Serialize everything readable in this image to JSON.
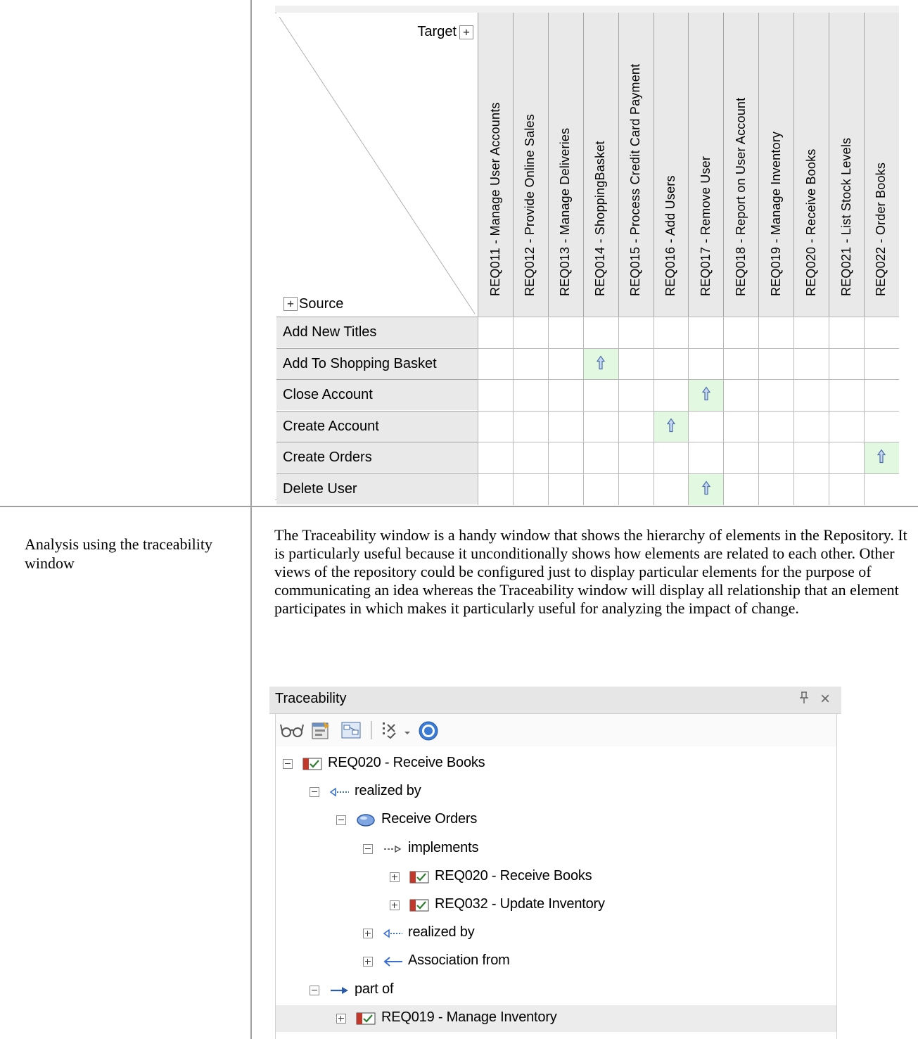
{
  "matrix": {
    "corner_target": "Target",
    "corner_source": "Source",
    "plus_symbol": "+",
    "columns": [
      "REQ011 - Manage User Accounts",
      "REQ012 - Provide Online Sales",
      "REQ013 - Manage Deliveries",
      "REQ014 - ShoppingBasket",
      "REQ015 - Process Credit Card Payment",
      "REQ016 - Add Users",
      "REQ017 - Remove User",
      "REQ018 - Report on User Account",
      "REQ019 - Manage Inventory",
      "REQ020 - Receive Books",
      "REQ021 - List Stock Levels",
      "REQ022 - Order Books"
    ],
    "rows": [
      "Add New Titles",
      "Add To Shopping Basket",
      "Close Account",
      "Create Account",
      "Create Orders",
      "Delete User"
    ],
    "links": [
      [
        1,
        3
      ],
      [
        2,
        6
      ],
      [
        3,
        5
      ],
      [
        4,
        11
      ],
      [
        5,
        6
      ]
    ],
    "link_color": "#e3f8e0",
    "arrow_icon": "up-arrow-icon"
  },
  "section": {
    "label": "Analysis using the traceability window",
    "paragraph": "The Traceability window is a handy window that shows the hierarchy of elements in the Repository. It is particularly useful because it unconditionally shows how elements are related to each other. Other views of the repository could be configured just to display particular elements for the purpose of communicating an idea whereas the Traceability window will display all relationship that an element participates in which makes it particularly useful for analyzing the impact of change."
  },
  "traceability": {
    "title": "Traceability",
    "pin_glyph": "ᵖ",
    "close_glyph": "×",
    "toolbar": [
      "glasses-icon",
      "properties-icon",
      "diagram-icon",
      "filter-icon",
      "dropdown-icon",
      "help-icon"
    ],
    "tree": [
      {
        "label": "REQ020 - Receive Books",
        "level": 0,
        "expanded": true,
        "icon": "requirement-icon"
      },
      {
        "label": "realized by",
        "level": 1,
        "expanded": true,
        "icon": "realization-icon"
      },
      {
        "label": "Receive Orders",
        "level": 2,
        "expanded": true,
        "icon": "usecase-icon"
      },
      {
        "label": "implements",
        "level": 3,
        "expanded": true,
        "icon": "realize-arrow-icon"
      },
      {
        "label": "REQ020 - Receive Books",
        "level": 4,
        "expanded": false,
        "icon": "requirement-icon"
      },
      {
        "label": "REQ032 - Update Inventory",
        "level": 4,
        "expanded": false,
        "icon": "requirement-icon"
      },
      {
        "label": "realized by",
        "level": 3,
        "expanded": false,
        "icon": "realization-icon"
      },
      {
        "label": "Association from",
        "level": 3,
        "expanded": false,
        "icon": "association-icon"
      },
      {
        "label": "part of",
        "level": 1,
        "expanded": true,
        "icon": "aggregation-icon"
      },
      {
        "label": "REQ019 - Manage Inventory",
        "level": 2,
        "expanded": false,
        "icon": "requirement-icon",
        "selected": true
      }
    ]
  }
}
